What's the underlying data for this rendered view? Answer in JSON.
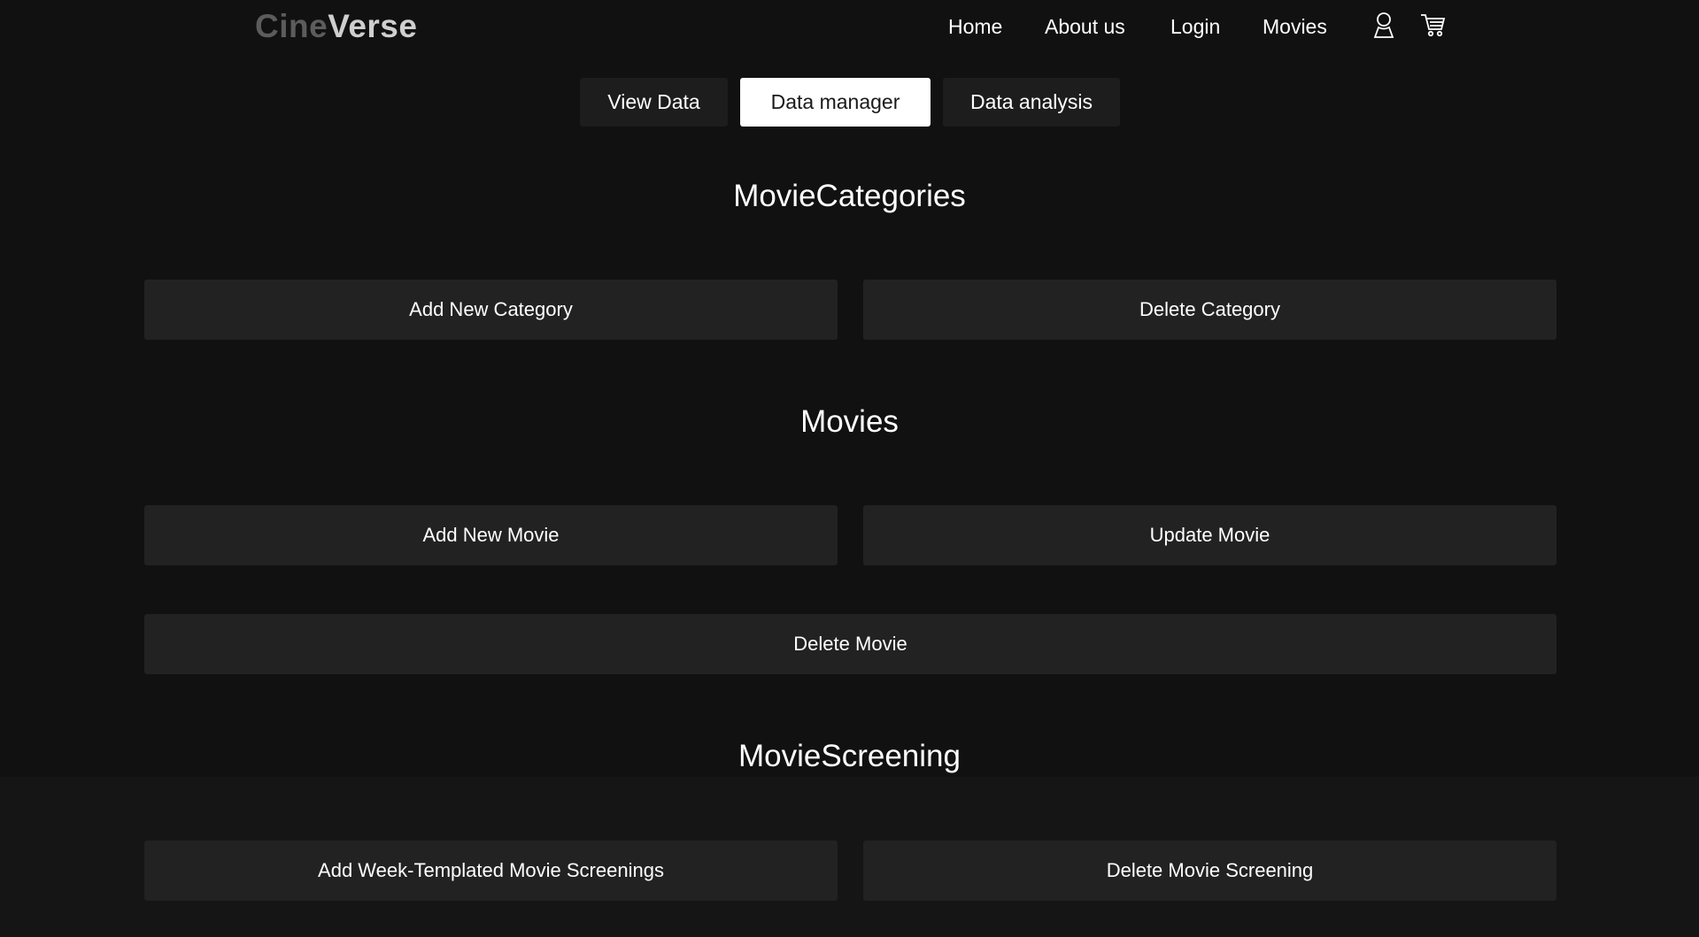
{
  "header": {
    "logo_part1": "Cine",
    "logo_part2": "Verse",
    "nav": [
      "Home",
      "About us",
      "Login",
      "Movies"
    ],
    "icons": [
      "user-icon",
      "cart-icon"
    ]
  },
  "tabs": [
    {
      "label": "View Data",
      "active": false
    },
    {
      "label": "Data manager",
      "active": true
    },
    {
      "label": "Data analysis",
      "active": false
    }
  ],
  "sections": {
    "categories": {
      "title": "MovieCategories",
      "buttons": [
        "Add New Category",
        "Delete Category"
      ]
    },
    "movies": {
      "title": "Movies",
      "buttons": [
        "Add New Movie",
        "Update Movie",
        "Delete Movie"
      ]
    },
    "screening": {
      "title": "MovieScreening",
      "buttons": [
        "Add Week-Templated Movie Screenings",
        "Delete Movie Screening"
      ]
    }
  },
  "colors": {
    "background": "#111111",
    "button": "#222222",
    "active_tab": "#ffffff"
  }
}
